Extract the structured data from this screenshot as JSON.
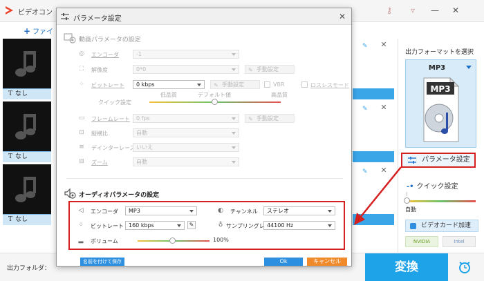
{
  "app": {
    "title": "ビデオコン",
    "add_file": "ファイ"
  },
  "colors": {
    "accent": "#1fa3e8",
    "highlight_border": "#d62020",
    "cancel": "#f08a2a"
  },
  "file_items": [
    {
      "label": "なし"
    },
    {
      "label": "なし"
    },
    {
      "label": "なし"
    }
  ],
  "right_panel": {
    "output_format_title": "出力フォーマットを選択",
    "format_name": "MP3",
    "file_icon_text": "MP3",
    "param_button": "パラメータ設定",
    "quick_setting": "クイック設定",
    "quick_auto": "自動",
    "gpu_accel": "ビデオカード加速",
    "nvidia": "NVIDIA",
    "intel": "Intel"
  },
  "bottom": {
    "output_folder": "出力フォルダ：",
    "convert": "変換"
  },
  "dialog": {
    "title": "パラメータ設定",
    "video_section": "動画パラメータの設定",
    "video": {
      "encoder_label": "エンコーダ",
      "encoder_value": "-1",
      "resolution_label": "解像度",
      "resolution_value": "0*0",
      "manual_label": "手動設定",
      "bitrate_label": "ビットレート",
      "bitrate_value": "0 kbps",
      "manual_label_2": "手動設定",
      "vbr_label": "VBR",
      "lossless_label": "ロスレスモード",
      "quick_label": "クイック設定",
      "low_quality": "低品質",
      "default_value": "デフォルト値",
      "high_quality": "高品質",
      "framerate_label": "フレームレート",
      "framerate_value": "0 fps",
      "manual_label_3": "手動設定",
      "aspect_label": "縦横比",
      "aspect_value": "自動",
      "deinterlace_label": "デインターレース",
      "deinterlace_value": "いいえ",
      "zoom_label": "ズーム",
      "zoom_value": "自動"
    },
    "audio_section": "オーディオパラメータの設定",
    "audio": {
      "encoder_label": "エンコーダ",
      "encoder_value": "MP3",
      "channel_label": "チャンネル",
      "channel_value": "ステレオ",
      "bitrate_label": "ビットレート",
      "bitrate_value": "160 kbps",
      "samplerate_label": "サンプリングレート",
      "samplerate_value": "44100 Hz",
      "volume_label": "ボリューム",
      "volume_percent": "100%"
    },
    "save_as": "名前を付けて保存",
    "ok": "Ok",
    "cancel": "キャンセル"
  }
}
